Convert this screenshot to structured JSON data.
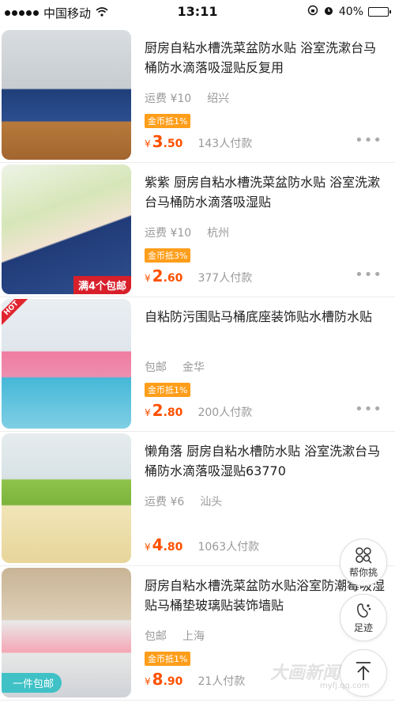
{
  "status_bar": {
    "carrier": "中国移动",
    "time": "13:11",
    "battery": "40%",
    "battery_level": 0.4
  },
  "products": [
    {
      "title": "厨房自粘水槽洗菜盆防水贴 浴室洗漱台马桶防水滴落吸湿贴反复用",
      "shipping": "运费 ¥10",
      "location": "绍兴",
      "coin_badge": "金币抵1%",
      "price_yen": "¥",
      "price_int": "3",
      "price_dec": ".50",
      "sold": "143人付款",
      "image_icon": "sink-mat-image"
    },
    {
      "title": "紫紫 厨房自粘水槽洗菜盆防水贴 浴室洗漱台马桶防水滴落吸湿贴",
      "shipping": "运费 ¥10",
      "location": "杭州",
      "coin_badge": "金币抵3%",
      "price_yen": "¥",
      "price_int": "2",
      "price_dec": ".60",
      "sold": "377人付款",
      "image_icon": "patterned-strips-image",
      "promo": "满4个包邮"
    },
    {
      "title": "自粘防污围贴马桶底座装饰贴水槽防水贴",
      "shipping": "包邮",
      "location": "金华",
      "coin_badge": "金币抵1%",
      "price_yen": "¥",
      "price_int": "2",
      "price_dec": ".80",
      "sold": "200人付款",
      "image_icon": "toilet-base-sticker-image",
      "hot": "HOT"
    },
    {
      "title": "懒角落 厨房自粘水槽防水贴 浴室洗漱台马桶防水滴落吸湿贴63770",
      "shipping": "运费 ¥6",
      "location": "汕头",
      "coin_badge": "",
      "price_yen": "¥",
      "price_int": "4",
      "price_dec": ".80",
      "sold": "1063人付款",
      "image_icon": "green-counter-strip-image"
    },
    {
      "title": "厨房自粘水槽洗菜盆防水贴浴室防潮霉吸湿贴马桶垫玻璃贴装饰墙贴",
      "shipping": "包邮",
      "location": "上海",
      "coin_badge": "金币抵1%",
      "price_yen": "¥",
      "price_int": "8",
      "price_dec": ".90",
      "sold": "21人付款",
      "image_icon": "pink-tape-roll-image",
      "free": "一件包邮"
    }
  ],
  "more_glyph": "•••",
  "floating": {
    "help_label": "帮你挑",
    "footprint_label": "足迹"
  },
  "watermark": {
    "text": "大画新闻",
    "sub": "myfj.qq.com"
  },
  "colors": {
    "price": "#ff5000",
    "coin_badge": "#ff9e1b",
    "promo_red": "#d8202b",
    "free_teal": "#3fc1c6"
  }
}
